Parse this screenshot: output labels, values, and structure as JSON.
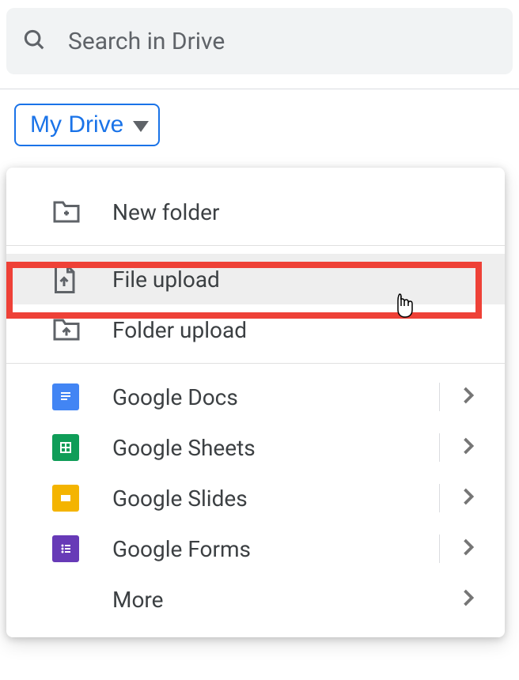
{
  "search": {
    "placeholder": "Search in Drive"
  },
  "myDriveBtn": {
    "label": "My Drive"
  },
  "menu": {
    "newFolder": "New folder",
    "fileUpload": "File upload",
    "folderUpload": "Folder upload",
    "googleDocs": "Google Docs",
    "googleSheets": "Google Sheets",
    "googleSlides": "Google Slides",
    "googleForms": "Google Forms",
    "more": "More"
  }
}
